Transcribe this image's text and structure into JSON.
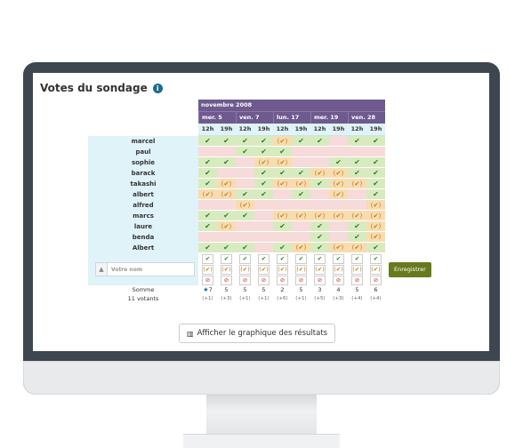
{
  "title": "Votes du sondage",
  "month": "novembre 2008",
  "days": [
    {
      "label": "mer. 5",
      "span": 2
    },
    {
      "label": "ven. 7",
      "span": 2
    },
    {
      "label": "lun. 17",
      "span": 2
    },
    {
      "label": "mer. 19",
      "span": 2
    },
    {
      "label": "ven. 28",
      "span": 2
    }
  ],
  "hours": [
    "12h",
    "19h",
    "12h",
    "19h",
    "12h",
    "19h",
    "12h",
    "19h",
    "12h",
    "19h"
  ],
  "voters": [
    {
      "name": "marcel",
      "votes": [
        "y",
        "y",
        "y",
        "y",
        "m",
        "y",
        "y",
        "n",
        "y",
        "y"
      ]
    },
    {
      "name": "paul",
      "votes": [
        "n",
        "n",
        "y",
        "y",
        "y",
        "n",
        "n",
        "n",
        "n",
        "n"
      ]
    },
    {
      "name": "sophie",
      "votes": [
        "y",
        "y",
        "n",
        "m",
        "m",
        "n",
        "n",
        "y",
        "y",
        "y"
      ]
    },
    {
      "name": "barack",
      "votes": [
        "y",
        "n",
        "n",
        "y",
        "y",
        "y",
        "m",
        "m",
        "y",
        "y"
      ]
    },
    {
      "name": "takashi",
      "votes": [
        "y",
        "m",
        "n",
        "y",
        "m",
        "m",
        "y",
        "m",
        "m",
        "y"
      ]
    },
    {
      "name": "albert",
      "votes": [
        "m",
        "m",
        "y",
        "y",
        "n",
        "y",
        "n",
        "m",
        "n",
        "y"
      ]
    },
    {
      "name": "alfred",
      "votes": [
        "n",
        "n",
        "m",
        "n",
        "n",
        "n",
        "n",
        "n",
        "n",
        "m"
      ]
    },
    {
      "name": "marcs",
      "votes": [
        "y",
        "y",
        "y",
        "n",
        "m",
        "m",
        "m",
        "m",
        "m",
        "m"
      ]
    },
    {
      "name": "laure",
      "votes": [
        "y",
        "m",
        "n",
        "n",
        "y",
        "n",
        "y",
        "n",
        "y",
        "m"
      ]
    },
    {
      "name": "benda",
      "votes": [
        "n",
        "n",
        "n",
        "n",
        "n",
        "n",
        "y",
        "n",
        "y",
        "m"
      ]
    },
    {
      "name": "Albert",
      "votes": [
        "y",
        "y",
        "y",
        "n",
        "y",
        "m",
        "y",
        "m",
        "m",
        "y"
      ]
    }
  ],
  "form": {
    "placeholder": "Votre nom",
    "save_label": "Enregistrer"
  },
  "totals": {
    "label": "Somme",
    "voters_label": "11 votants",
    "star": "★",
    "values": [
      "7",
      "5",
      "5",
      "5",
      "2",
      "5",
      "3",
      "4",
      "5",
      "6"
    ],
    "extras": [
      "(+1)",
      "(+3)",
      "(+1)",
      "(+1)",
      "(+6)",
      "(+1)",
      "(+5)",
      "(+3)",
      "(+4)",
      "(+4)"
    ]
  },
  "graph_button": "Afficher le graphique des résultats",
  "colors": {
    "header": "#6e5a8e",
    "yes": "#d8ebc0",
    "maybe": "#f8dcb0",
    "no": "#f7dada",
    "save": "#667a1e"
  }
}
